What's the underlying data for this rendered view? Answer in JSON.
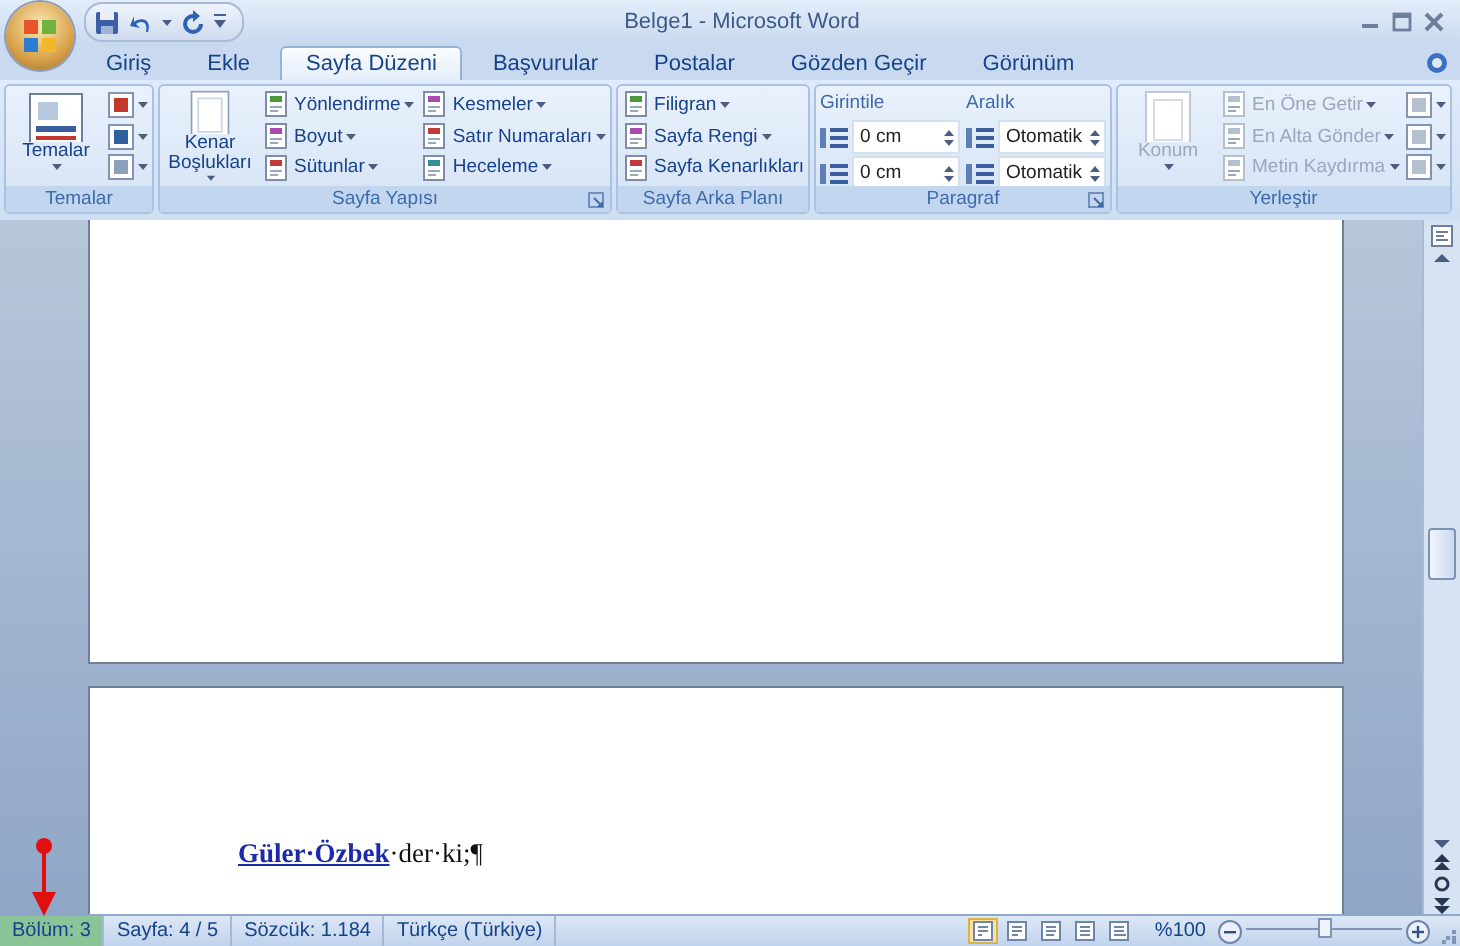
{
  "window": {
    "title": "Belge1 - Microsoft Word"
  },
  "tabs": [
    {
      "label": "Giriş",
      "selected": false
    },
    {
      "label": "Ekle",
      "selected": false
    },
    {
      "label": "Sayfa Düzeni",
      "selected": true
    },
    {
      "label": "Başvurular",
      "selected": false
    },
    {
      "label": "Postalar",
      "selected": false
    },
    {
      "label": "Gözden Geçir",
      "selected": false
    },
    {
      "label": "Görünüm",
      "selected": false
    }
  ],
  "ribbon": {
    "groups": [
      {
        "label": "Temalar",
        "launcher": false,
        "disabled": false,
        "columns": [
          {
            "kind": "large",
            "label": "Temalar",
            "dropdown": true
          },
          {
            "kind": "stack",
            "items": [
              {
                "kind": "icon",
                "dropdown": true
              },
              {
                "kind": "icon",
                "dropdown": true
              },
              {
                "kind": "icon",
                "dropdown": true
              }
            ]
          }
        ]
      },
      {
        "label": "Sayfa Yapısı",
        "launcher": true,
        "disabled": false,
        "columns": [
          {
            "kind": "large",
            "label": "Kenar Boşlukları",
            "dropdown": true
          },
          {
            "kind": "stack",
            "items": [
              {
                "kind": "small",
                "label": "Yönlendirme",
                "dropdown": true
              },
              {
                "kind": "small",
                "label": "Boyut",
                "dropdown": true
              },
              {
                "kind": "small",
                "label": "Sütunlar",
                "dropdown": true
              }
            ]
          },
          {
            "kind": "stack",
            "items": [
              {
                "kind": "small",
                "label": "Kesmeler",
                "dropdown": true
              },
              {
                "kind": "small",
                "label": "Satır Numaraları",
                "dropdown": true
              },
              {
                "kind": "small",
                "label": "Heceleme",
                "dropdown": true
              }
            ]
          }
        ]
      },
      {
        "label": "Sayfa Arka Planı",
        "launcher": false,
        "disabled": false,
        "columns": [
          {
            "kind": "stack",
            "items": [
              {
                "kind": "small",
                "label": "Filigran",
                "dropdown": true
              },
              {
                "kind": "small",
                "label": "Sayfa Rengi",
                "dropdown": true
              },
              {
                "kind": "small",
                "label": "Sayfa Kenarlıkları",
                "dropdown": false
              }
            ]
          }
        ]
      },
      {
        "label": "Paragraf",
        "launcher": true,
        "disabled": false,
        "columns": [
          {
            "kind": "stack",
            "header": "Girintile",
            "items": [
              {
                "kind": "spin",
                "value": "0 cm"
              },
              {
                "kind": "spin",
                "value": "0 cm"
              }
            ]
          },
          {
            "kind": "stack",
            "header": "Aralık",
            "items": [
              {
                "kind": "spin",
                "value": "Otomatik"
              },
              {
                "kind": "spin",
                "value": "Otomatik"
              }
            ]
          }
        ]
      },
      {
        "label": "Yerleştir",
        "launcher": false,
        "disabled": true,
        "columns": [
          {
            "kind": "large",
            "label": "Konum",
            "dropdown": true
          },
          {
            "kind": "stack",
            "items": [
              {
                "kind": "small",
                "label": "En Öne Getir",
                "dropdown": true
              },
              {
                "kind": "small",
                "label": "En Alta Gönder",
                "dropdown": true
              },
              {
                "kind": "small",
                "label": "Metin Kaydırma",
                "dropdown": true
              }
            ]
          },
          {
            "kind": "stack",
            "items": [
              {
                "kind": "icon",
                "dropdown": true
              },
              {
                "kind": "icon",
                "dropdown": true
              },
              {
                "kind": "icon",
                "dropdown": true
              }
            ]
          }
        ]
      }
    ]
  },
  "document": {
    "paragraphs": [
      {
        "link": "Güler·Özbek",
        "text": "·der·ki;¶"
      }
    ]
  },
  "status_bar": {
    "items": [
      {
        "label": "Bölüm: 3",
        "highlighted": true
      },
      {
        "label": "Sayfa: 4 / 5",
        "highlighted": false
      },
      {
        "label": "Sözcük: 1.184",
        "highlighted": false
      },
      {
        "label": "Türkçe (Türkiye)",
        "highlighted": false
      }
    ],
    "views": [
      {
        "selected": true
      },
      {
        "selected": false
      },
      {
        "selected": false
      },
      {
        "selected": false
      },
      {
        "selected": false
      }
    ],
    "zoom": {
      "label": "%100",
      "level": 0.5
    }
  }
}
